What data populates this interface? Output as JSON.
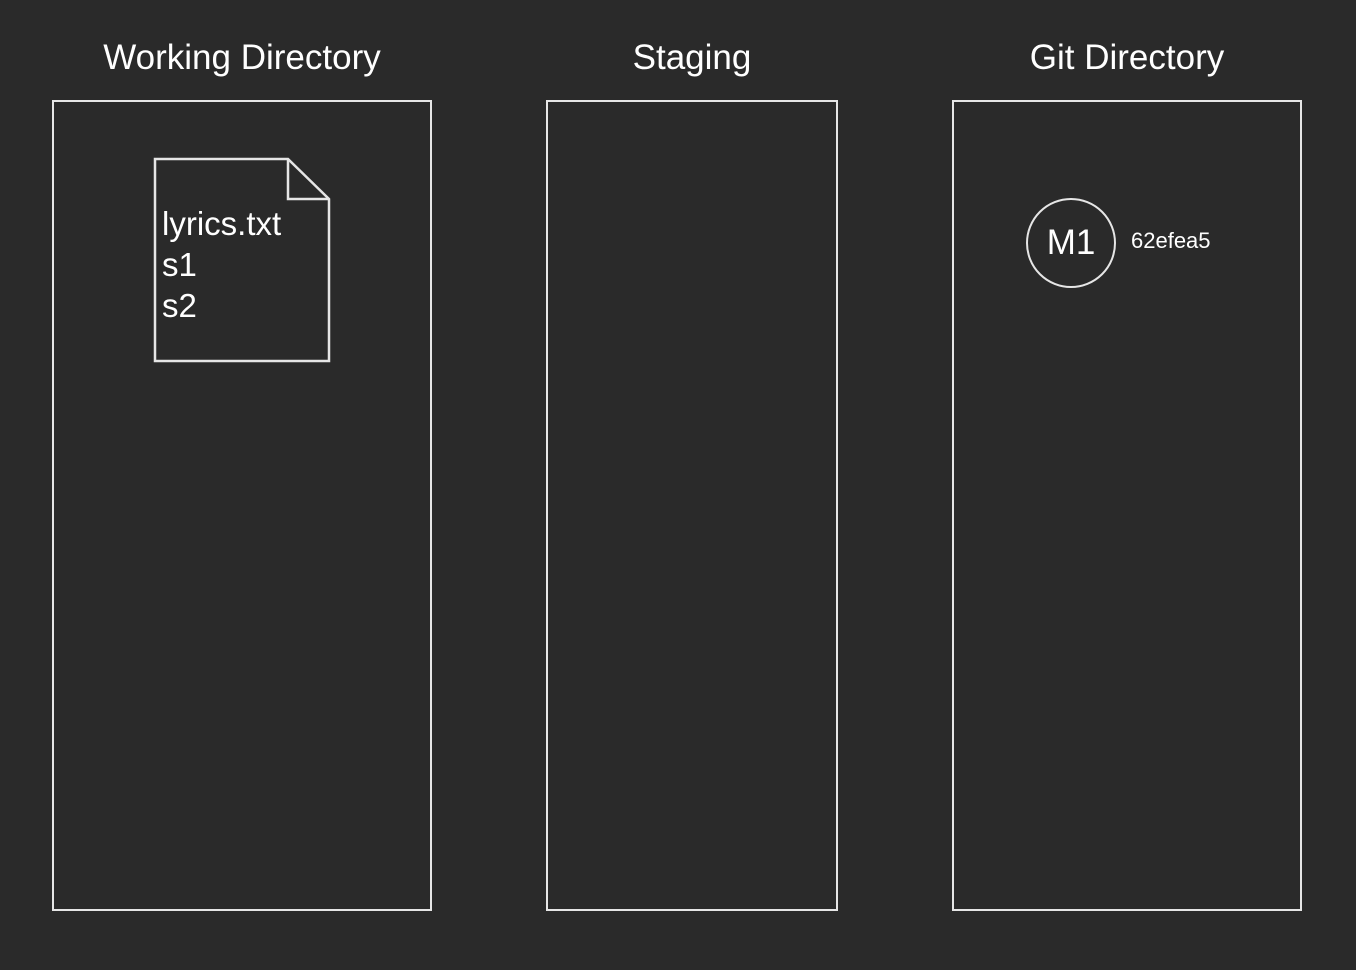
{
  "areas": {
    "working_directory": {
      "title": "Working Directory",
      "file": {
        "lines": [
          "lyrics.txt",
          "s1",
          "s2"
        ]
      }
    },
    "staging": {
      "title": "Staging"
    },
    "git_directory": {
      "title": "Git Directory",
      "commit": {
        "label": "M1",
        "hash": "62efea5"
      }
    }
  },
  "colors": {
    "background": "#2a2a2a",
    "stroke": "#e6e6e6",
    "text": "#ffffff"
  }
}
